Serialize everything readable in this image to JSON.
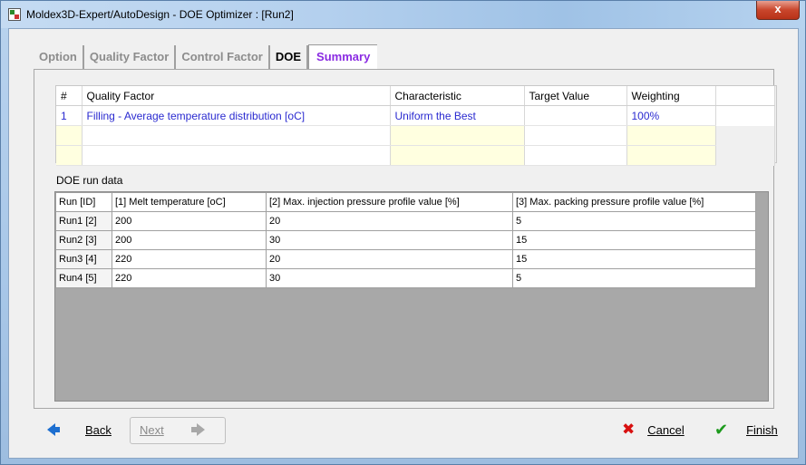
{
  "window": {
    "title": "Moldex3D-Expert/AutoDesign - DOE Optimizer : [Run2]",
    "close_label": "x"
  },
  "tabs": [
    {
      "label": "Option",
      "state": "inactive"
    },
    {
      "label": "Quality Factor",
      "state": "inactive"
    },
    {
      "label": "Control Factor",
      "state": "inactive"
    },
    {
      "label": "DOE",
      "state": "inactive-dark"
    },
    {
      "label": "Summary",
      "state": "active"
    }
  ],
  "quality_table": {
    "headers": [
      "#",
      "Quality Factor",
      "Characteristic",
      "Target Value",
      "Weighting"
    ],
    "rows": [
      [
        "1",
        "Filling - Average temperature distribution [oC]",
        "Uniform the Best",
        "",
        "100%"
      ]
    ]
  },
  "doe": {
    "label": "DOE run data",
    "headers": [
      "Run [ID]",
      "[1] Melt temperature [oC]",
      "[2] Max. injection pressure profile value [%]",
      "[3] Max. packing pressure profile value [%]"
    ],
    "rows": [
      [
        "Run1 [2]",
        "200",
        "20",
        "5"
      ],
      [
        "Run2 [3]",
        "200",
        "30",
        "15"
      ],
      [
        "Run3 [4]",
        "220",
        "20",
        "15"
      ],
      [
        "Run4 [5]",
        "220",
        "30",
        "5"
      ]
    ]
  },
  "footer": {
    "back_label": "Back",
    "next_label": "Next",
    "cancel_label": "Cancel",
    "finish_label": "Finish"
  },
  "icons": {
    "app": "moldex-app-icon",
    "back": "arrow-left-icon",
    "next": "arrow-right-icon",
    "cancel": "red-x-icon",
    "finish": "green-check-icon"
  },
  "colors": {
    "active_tab": "#8a2be2",
    "row_text": "#2a2ad0",
    "empty_highlight": "#ffffe0",
    "cancel_red": "#d81010",
    "finish_green": "#1d9a1d",
    "back_blue": "#1d6fd0"
  }
}
